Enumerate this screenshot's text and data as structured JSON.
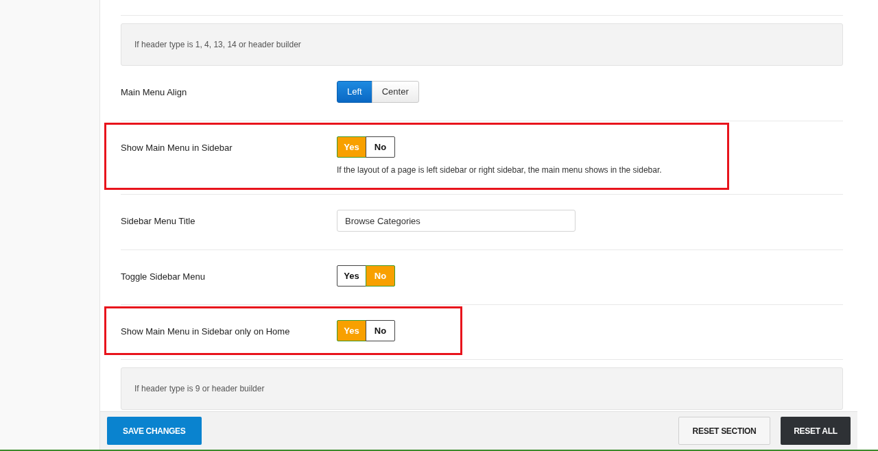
{
  "rows": [
    {
      "kind": "info",
      "text": "If header type is 1, 4, 13, 14 or header builder"
    },
    {
      "kind": "buttonset",
      "label": "Main Menu Align",
      "highlighted": false,
      "options": [
        {
          "label": "Left",
          "selected": true
        },
        {
          "label": "Center",
          "selected": false
        }
      ]
    },
    {
      "kind": "switch",
      "label": "Show Main Menu in Sidebar",
      "highlighted": true,
      "options": [
        {
          "label": "Yes",
          "selected": true
        },
        {
          "label": "No",
          "selected": false
        }
      ],
      "description": "If the layout of a page is left sidebar or right sidebar, the main menu shows in the sidebar."
    },
    {
      "kind": "text",
      "label": "Sidebar Menu Title",
      "highlighted": false,
      "value": "Browse Categories"
    },
    {
      "kind": "switch",
      "label": "Toggle Sidebar Menu",
      "highlighted": false,
      "options": [
        {
          "label": "Yes",
          "selected": false
        },
        {
          "label": "No",
          "selected": true
        }
      ]
    },
    {
      "kind": "switch",
      "label": "Show Main Menu in Sidebar only on Home",
      "highlighted": true,
      "options": [
        {
          "label": "Yes",
          "selected": true
        },
        {
          "label": "No",
          "selected": false
        }
      ]
    },
    {
      "kind": "info",
      "text": "If header type is 9 or header builder"
    }
  ],
  "footer": {
    "save": "SAVE CHANGES",
    "reset_section": "RESET SECTION",
    "reset_all": "RESET ALL"
  }
}
